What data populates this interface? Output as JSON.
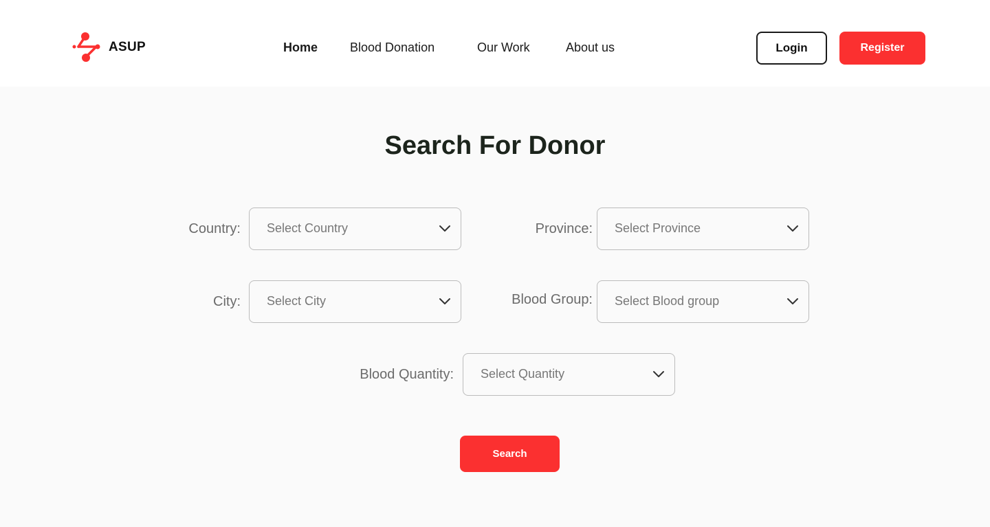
{
  "brand": {
    "name": "ASUP",
    "accent_color": "#fb3030",
    "logo_icon": "network-nodes-logo-icon"
  },
  "nav": {
    "items": [
      {
        "label": "Home",
        "active": true
      },
      {
        "label": "Blood Donation",
        "active": false
      },
      {
        "label": "Our Work",
        "active": false
      },
      {
        "label": "About us",
        "active": false
      }
    ]
  },
  "auth": {
    "login_label": "Login",
    "register_label": "Register"
  },
  "page": {
    "title": "Search For Donor"
  },
  "form": {
    "country": {
      "label": "Country:",
      "placeholder": "Select Country"
    },
    "province": {
      "label": "Province:",
      "placeholder": "Select Province"
    },
    "city": {
      "label": "City:",
      "placeholder": "Select City"
    },
    "blood_group": {
      "label": "Blood Group:",
      "placeholder": "Select Blood group"
    },
    "blood_quantity": {
      "label": "Blood Quantity:",
      "placeholder": "Select Quantity"
    },
    "dropdown_icon": "chevron-down-icon",
    "search_label": "Search"
  }
}
